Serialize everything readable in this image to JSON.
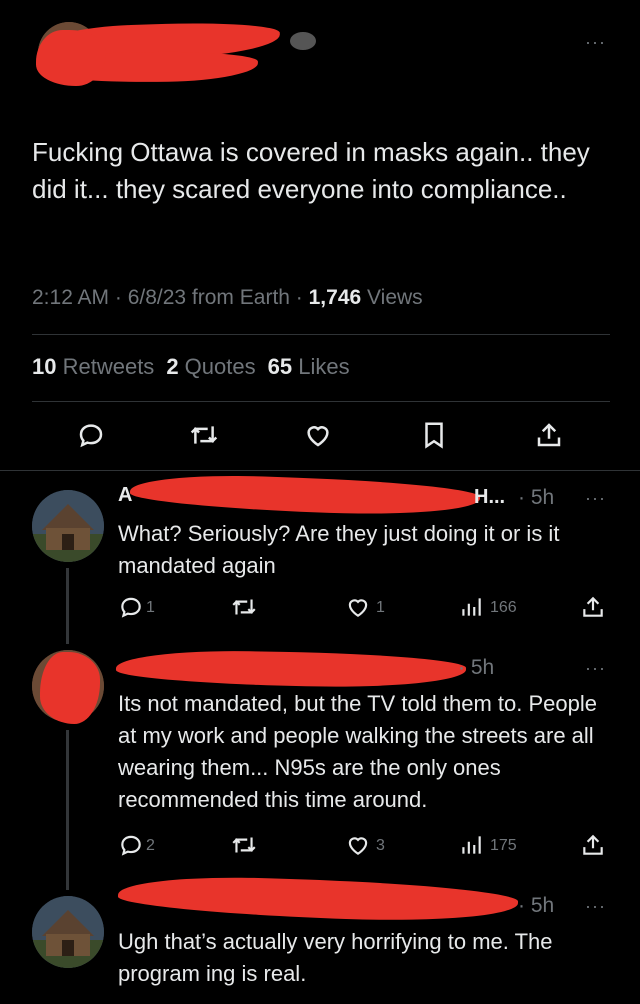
{
  "main_tweet": {
    "text": "Fucking Ottawa is covered in masks again.. they did it... they scared everyone into compliance..",
    "time": "2:12 AM · 6/8/23 from Earth · ",
    "views_count": "1,746",
    "views_label": " Views",
    "retweets_count": "10",
    "retweets_label": " Retweets",
    "quotes_count": "2",
    "quotes_label": " Quotes",
    "likes_count": "65",
    "likes_label": " Likes",
    "more": "···"
  },
  "replies": [
    {
      "name_start": "A",
      "name_end": "H...",
      "time": "· 5h",
      "text": "What? Seriously? Are they just doing it or is it mandated again",
      "replies": "1",
      "retweets": "",
      "likes": "1",
      "views": "166",
      "more": "···"
    },
    {
      "time": "· 5h",
      "text": "Its not mandated, but the TV told them to. People at my work and people walking the streets are all wearing them... N95s are the only ones recommended this time around.",
      "replies": "2",
      "retweets": "",
      "likes": "3",
      "views": "175",
      "more": "···"
    },
    {
      "time": "· 5h",
      "text": "Ugh that’s actually very horrifying to me. The program ing is real.",
      "more": "···"
    }
  ],
  "colors": {
    "background": "#000000",
    "text": "#e7e9ea",
    "secondary": "#71767b",
    "redaction": "#e8342b"
  }
}
